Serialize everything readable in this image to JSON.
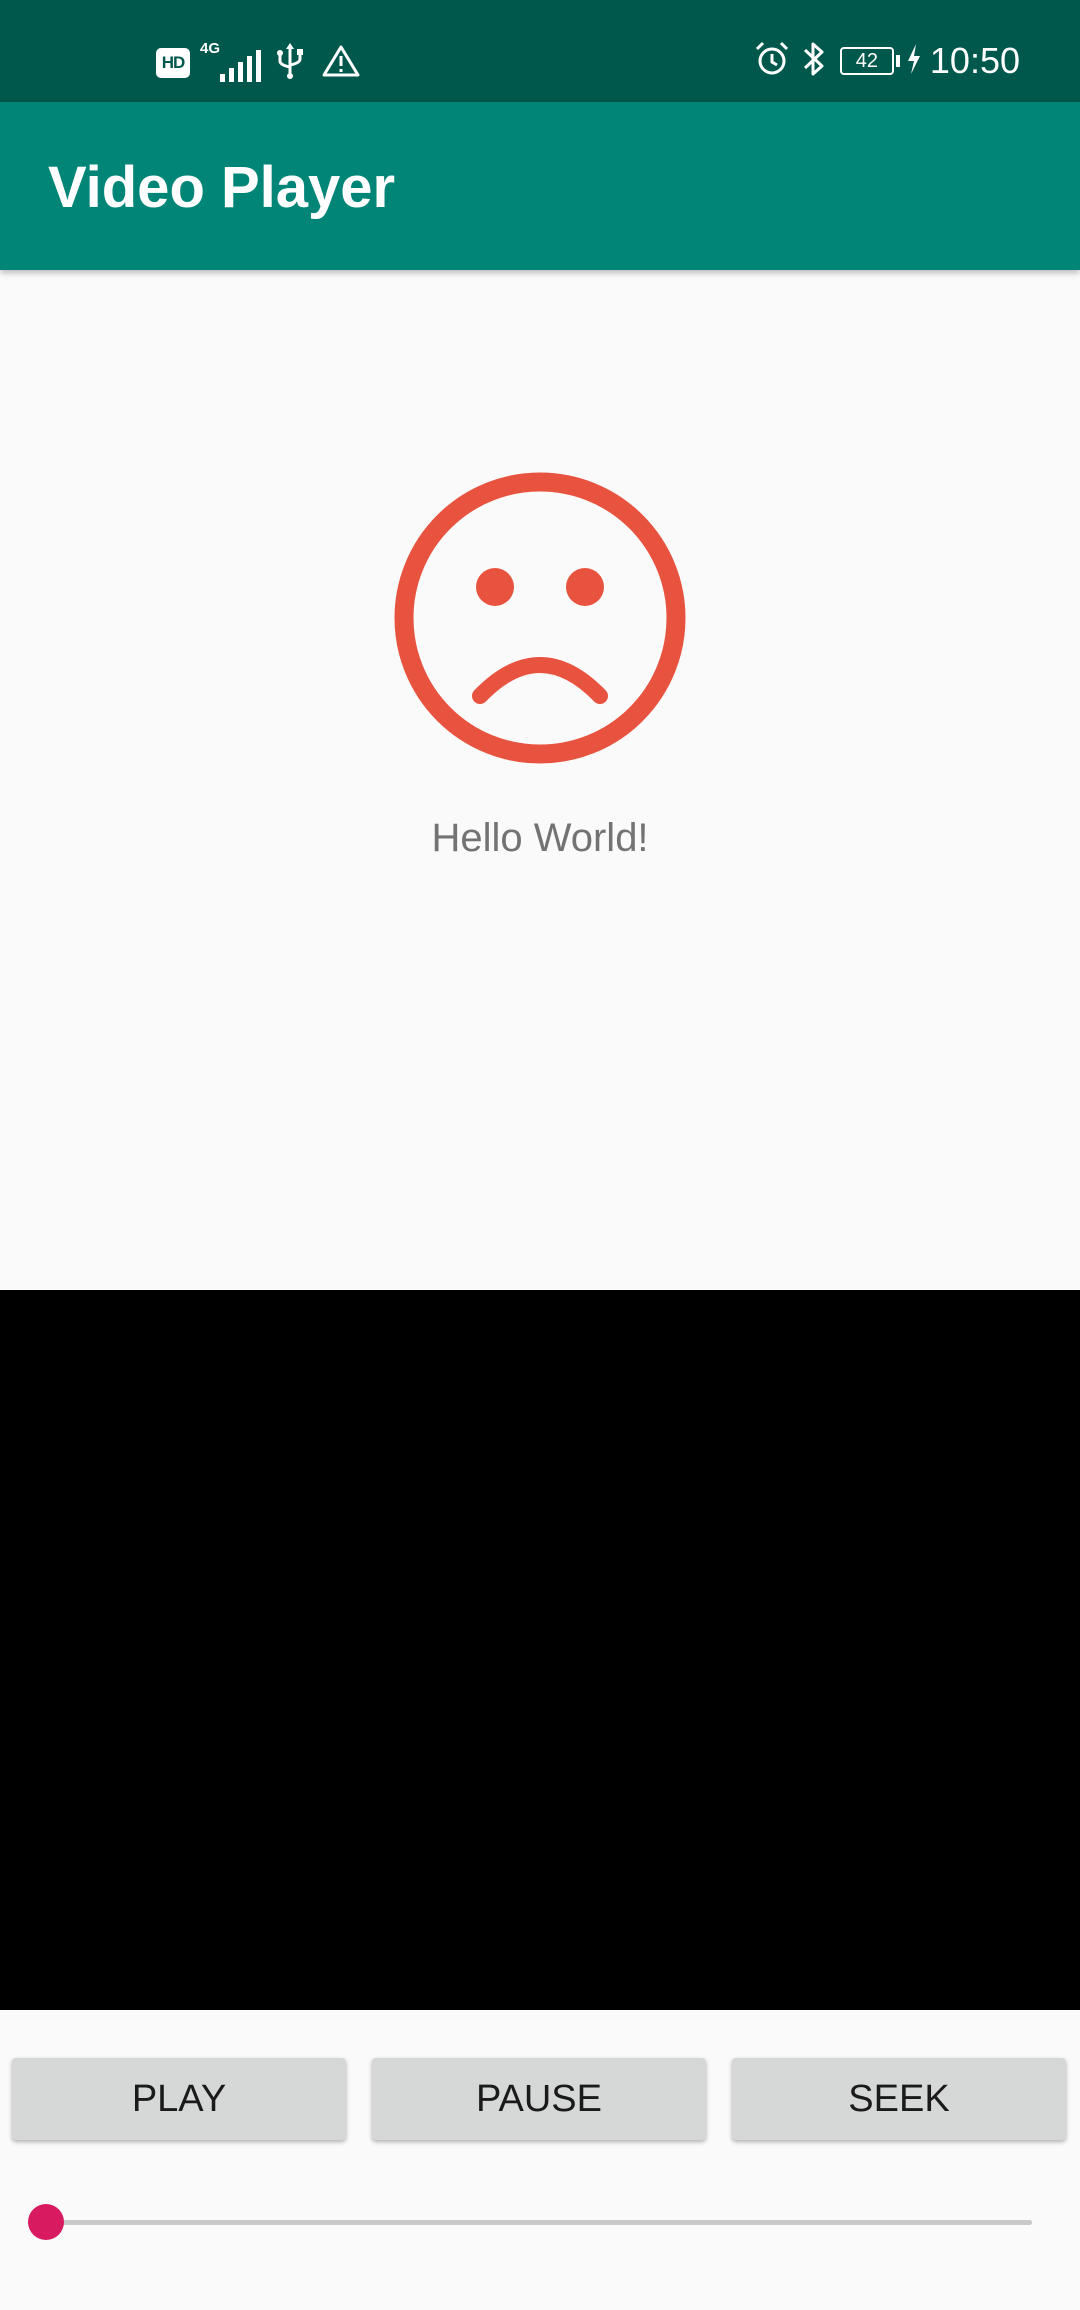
{
  "status_bar": {
    "hd_label": "HD",
    "network_label": "4G",
    "battery_level": "42",
    "time": "10:50",
    "icons": [
      "hd-icon",
      "signal-icon",
      "usb-icon",
      "warning-icon",
      "alarm-icon",
      "bluetooth-icon",
      "battery-icon",
      "charging-icon"
    ]
  },
  "app_bar": {
    "title": "Video Player"
  },
  "content": {
    "illustration_icon": "sad-face-icon",
    "illustration_color": "#e8533f",
    "message": "Hello World!"
  },
  "video": {
    "background": "#000000"
  },
  "controls": {
    "play_label": "PLAY",
    "pause_label": "PAUSE",
    "seek_label": "SEEK"
  },
  "seekbar": {
    "progress": 0,
    "accent_color": "#d81b60"
  },
  "colors": {
    "status_bar": "#00574b",
    "app_bar": "#008577",
    "background": "#fafafa"
  }
}
